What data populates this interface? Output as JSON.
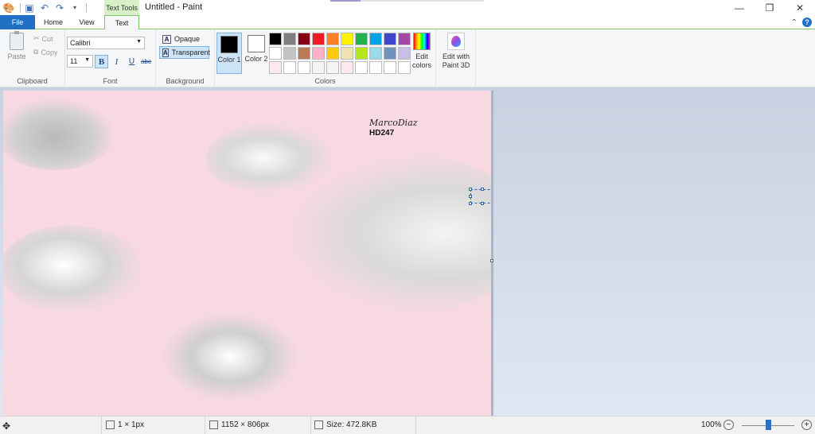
{
  "app": {
    "title": "Untitled - Paint",
    "context_tab": "Text Tools"
  },
  "quick_access": [
    {
      "icon": "paint-app-icon"
    },
    {
      "icon": "save-icon"
    },
    {
      "icon": "undo-icon"
    },
    {
      "icon": "redo-icon"
    },
    {
      "icon": "customize-dropdown-icon"
    }
  ],
  "window_controls": {
    "minimize": "—",
    "restore": "❐",
    "close": "✕"
  },
  "tabs": [
    {
      "label": "File"
    },
    {
      "label": "Home"
    },
    {
      "label": "View"
    },
    {
      "label": "Text"
    }
  ],
  "ribbon": {
    "collapse_glyph": "⌃",
    "help_glyph": "?",
    "clipboard": {
      "label": "Clipboard",
      "paste": "Paste",
      "cut": "Cut",
      "copy": "Copy"
    },
    "font": {
      "label": "Font",
      "family": "Calibri",
      "size": "11",
      "bold": "B",
      "italic": "I",
      "underline": "U",
      "strike": "abc"
    },
    "background": {
      "label": "Background",
      "opaque": "Opaque",
      "transparent": "Transparent",
      "selected": "transparent"
    },
    "colors": {
      "label": "Colors",
      "color1_label": "Color 1",
      "color2_label": "Color 2",
      "color1": "#000000",
      "color2": "#ffffff",
      "edit_colors": "Edit colors",
      "paint3d": "Edit with Paint 3D",
      "palette": [
        "#000000",
        "#7f7f7f",
        "#880015",
        "#ed1c24",
        "#ff7f27",
        "#fff200",
        "#22b14c",
        "#00a2e8",
        "#3f48cc",
        "#a349a4",
        "#ffffff",
        "#c3c3c3",
        "#b97a57",
        "#ffaec9",
        "#ffc90e",
        "#efe4b0",
        "#b5e61d",
        "#99d9ea",
        "#7092be",
        "#c8bfe7",
        "#fde8ee",
        "#ffffff",
        "#ffffff",
        "#f4f4f4",
        "#f4f4f4",
        "#fde8ee",
        "#ffffff",
        "#ffffff",
        "#ffffff",
        "#ffffff"
      ]
    }
  },
  "canvas": {
    "background": "#f8d9e1",
    "signature_name": "MarcoDiaz",
    "signature_code": "HD247"
  },
  "status": {
    "cursor_pos": "",
    "selection_size": "1 × 1px",
    "image_size": "1152 × 806px",
    "file_size": "Size: 472.8KB",
    "zoom": "100%",
    "zoom_out": "−",
    "zoom_in": "+"
  }
}
